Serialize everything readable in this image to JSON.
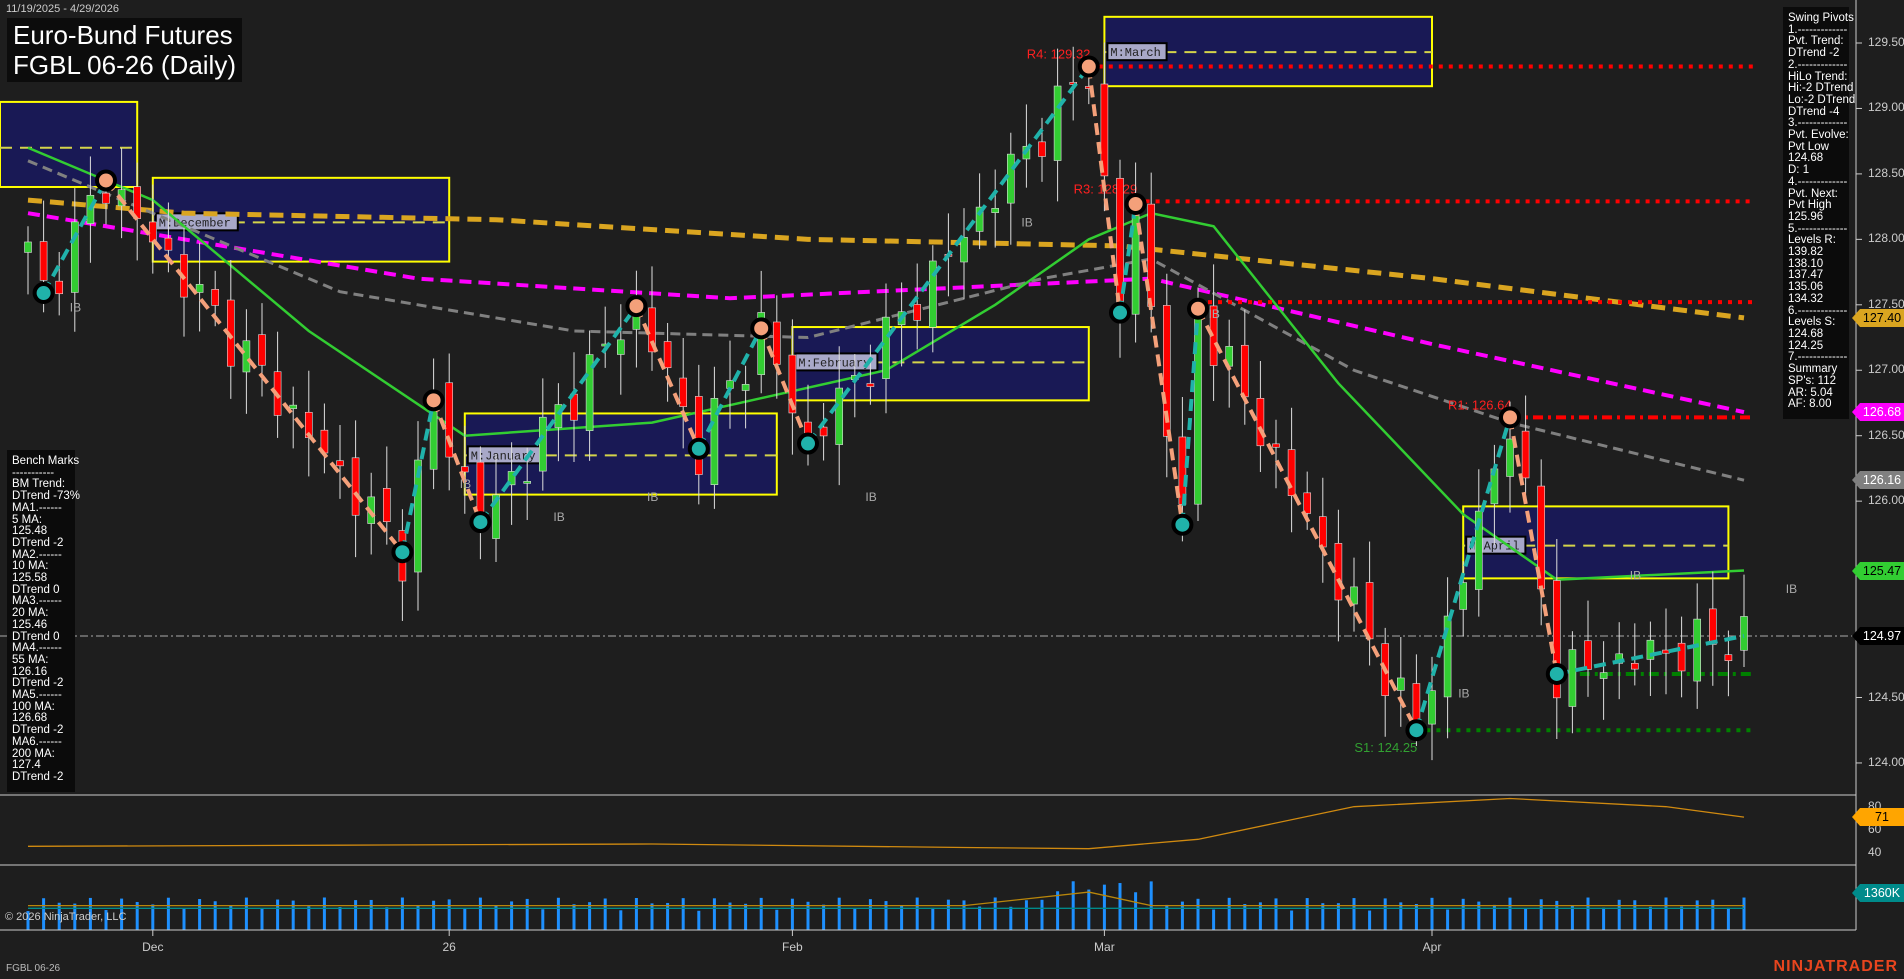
{
  "header": {
    "date_range": "11/19/2025 - 4/29/2026",
    "title_line1": "Euro-Bund Futures",
    "title_line2": "FGBL 06-26 (Daily)"
  },
  "swing_pivots_panel": [
    "Swing Pivots",
    "1.-------------",
    "Pvt. Trend:",
    "DTrend -2",
    "2.-------------",
    "HiLo Trend:",
    "Hi:-2 DTrend",
    "Lo:-2 DTrend",
    "DTrend -4",
    "3.-------------",
    "Pvt. Evolve:",
    "Pvt Low",
    "124.68",
    "D: 1",
    "4.-------------",
    "Pvt. Next:",
    "Pvt High",
    "125.96",
    "5.-------------",
    "Levels R:",
    "139.82",
    "138.10",
    "137.47",
    "135.06",
    "134.32",
    "6.-------------",
    "Levels S:",
    "124.68",
    "124.25",
    "7.-------------",
    "Summary",
    "SP's: 112",
    "AR: 5.04",
    "AF: 8.00"
  ],
  "bench_marks_panel": [
    "Bench Marks",
    "-----------",
    "BM Trend:",
    "DTrend -73%",
    "MA1.------",
    "5 MA:",
    "125.48",
    "DTrend -2",
    "MA2.------",
    "10 MA:",
    "125.58",
    "DTrend 0",
    "MA3.------",
    "20 MA:",
    "125.46",
    "DTrend 0",
    "MA4.------",
    "55 MA:",
    "126.16",
    "DTrend -2",
    "MA5.------",
    "100 MA:",
    "126.68",
    "DTrend -2",
    "MA6.------",
    "200 MA:",
    "127.4",
    "DTrend -2"
  ],
  "price_axis": {
    "ticks": [
      "129.50",
      "129.00",
      "128.50",
      "128.00",
      "127.50",
      "127.00",
      "126.50",
      "126.00",
      "124.50",
      "124.00"
    ],
    "tick_values": [
      129.5,
      129.0,
      128.5,
      128.0,
      127.5,
      127.0,
      126.5,
      126.0,
      124.5,
      124.0
    ]
  },
  "price_tags": [
    {
      "label": "127.40",
      "value": 127.4,
      "bg": "#daa520",
      "fg": "#000"
    },
    {
      "label": "126.68",
      "value": 126.68,
      "bg": "#ff00ff",
      "fg": "#fff"
    },
    {
      "label": "126.16",
      "value": 126.16,
      "bg": "#808080",
      "fg": "#fff"
    },
    {
      "label": "125.47",
      "value": 125.47,
      "bg": "#32cd32",
      "fg": "#000"
    },
    {
      "label": "124.97",
      "value": 124.97,
      "bg": "#000000",
      "fg": "#fff"
    }
  ],
  "indicator_axis": {
    "ticks": [
      "80",
      "60",
      "40"
    ],
    "tag": "71",
    "tag_color": "#ffa500"
  },
  "volume_axis": {
    "tag": "1360K",
    "tag_color": "#008b8b"
  },
  "date_axis": [
    {
      "label": "Dec",
      "bar": 8
    },
    {
      "label": "26",
      "bar": 27
    },
    {
      "label": "Feb",
      "bar": 49
    },
    {
      "label": "Mar",
      "bar": 69
    },
    {
      "label": "Apr",
      "bar": 90
    }
  ],
  "footer": {
    "symbol": "FGBL 06-26",
    "copyright": "© 2026 NinjaTrader, LLC",
    "logo": "NINJATRADER"
  },
  "ib_label": "IB",
  "colors": {
    "up": "#32cd32",
    "down": "#ff0000",
    "zig_up": "#20b2aa",
    "zig_down": "#f4a07a",
    "box": "#191955",
    "box_border": "#ffff00"
  },
  "chart_data": {
    "type": "candlestick",
    "title": "Euro-Bund Futures FGBL 06-26 (Daily)",
    "bars": 111,
    "ylim": [
      123.9,
      129.75
    ],
    "swing_pivots": [
      [
        0,
        127.9
      ],
      [
        1,
        127.59
      ],
      [
        5,
        128.45
      ],
      [
        24,
        125.61
      ],
      [
        26,
        126.77
      ],
      [
        29,
        125.84
      ],
      [
        39,
        127.49
      ],
      [
        43,
        126.4
      ],
      [
        47,
        127.32
      ],
      [
        50,
        126.44
      ],
      [
        68,
        129.32
      ],
      [
        70,
        127.44
      ],
      [
        71,
        128.27
      ],
      [
        74,
        125.82
      ],
      [
        75,
        127.47
      ],
      [
        89,
        124.25
      ],
      [
        95,
        126.64
      ],
      [
        98,
        124.68
      ],
      [
        110,
        124.97
      ]
    ],
    "moving_averages": [
      {
        "name": "200 MA",
        "value": 127.4,
        "color": "#daa520",
        "dash": "14 8",
        "width": 5,
        "points": [
          [
            0,
            128.3
          ],
          [
            10,
            128.2
          ],
          [
            30,
            128.15
          ],
          [
            50,
            128.0
          ],
          [
            70,
            127.95
          ],
          [
            90,
            127.7
          ],
          [
            110,
            127.4
          ]
        ]
      },
      {
        "name": "100 MA",
        "value": 126.68,
        "color": "#ff00ff",
        "dash": "12 7",
        "width": 4,
        "points": [
          [
            0,
            128.2
          ],
          [
            10,
            128.0
          ],
          [
            25,
            127.7
          ],
          [
            45,
            127.55
          ],
          [
            72,
            127.7
          ],
          [
            90,
            127.2
          ],
          [
            110,
            126.68
          ]
        ]
      },
      {
        "name": "55 MA",
        "value": 126.16,
        "color": "#808080",
        "dash": "10 6",
        "width": 3,
        "points": [
          [
            0,
            128.6
          ],
          [
            10,
            128.1
          ],
          [
            20,
            127.6
          ],
          [
            35,
            127.3
          ],
          [
            50,
            127.25
          ],
          [
            65,
            127.7
          ],
          [
            72,
            127.85
          ],
          [
            85,
            127.0
          ],
          [
            95,
            126.6
          ],
          [
            110,
            126.16
          ]
        ]
      },
      {
        "name": "20 MA",
        "value": 125.47,
        "color": "#32cd32",
        "dash": "",
        "width": 2.5,
        "points": [
          [
            0,
            128.7
          ],
          [
            8,
            128.3
          ],
          [
            18,
            127.3
          ],
          [
            28,
            126.5
          ],
          [
            40,
            126.6
          ],
          [
            55,
            127.0
          ],
          [
            62,
            127.5
          ],
          [
            68,
            128.0
          ],
          [
            72,
            128.2
          ],
          [
            76,
            128.1
          ],
          [
            84,
            126.9
          ],
          [
            92,
            125.9
          ],
          [
            98,
            125.4
          ],
          [
            110,
            125.47
          ]
        ]
      }
    ],
    "monthly_boxes": [
      {
        "label": "",
        "from": -3,
        "to": 7,
        "low": 128.4,
        "high": 129.05,
        "mid": 128.7
      },
      {
        "label": "M:December",
        "from": 8,
        "to": 27,
        "low": 127.83,
        "high": 128.47,
        "mid": 128.13
      },
      {
        "label": "M:January",
        "from": 28,
        "to": 48,
        "low": 126.05,
        "high": 126.67,
        "mid": 126.35
      },
      {
        "label": "M:February",
        "from": 49,
        "to": 68,
        "low": 126.77,
        "high": 127.33,
        "mid": 127.06
      },
      {
        "label": "M:March",
        "from": 69,
        "to": 90,
        "low": 129.17,
        "high": 129.7,
        "mid": 129.43
      },
      {
        "label": "M:April",
        "from": 92,
        "to": 109,
        "low": 125.41,
        "high": 125.96,
        "mid": 125.66
      }
    ],
    "levels": [
      {
        "label": "R4: 129.32",
        "value": 129.32,
        "from": 68,
        "color": "#ff0000",
        "style": "dot"
      },
      {
        "label": "R3: 128.29",
        "value": 128.29,
        "from": 71,
        "color": "#ff0000",
        "style": "dot"
      },
      {
        "label": "",
        "value": 127.52,
        "from": 75,
        "color": "#ff0000",
        "style": "dot"
      },
      {
        "label": "R1: 126.64",
        "value": 126.64,
        "from": 95,
        "color": "#ff0000",
        "style": "dashdot"
      },
      {
        "label": "S1: 124.25",
        "value": 124.25,
        "from": 89,
        "color": "#008000",
        "style": "dot"
      },
      {
        "label": "",
        "value": 124.68,
        "from": 98,
        "color": "#008000",
        "style": "dashdot"
      }
    ],
    "last_price": 124.97,
    "indicator": {
      "ylim": [
        30,
        90
      ],
      "points": [
        [
          0,
          46
        ],
        [
          20,
          47
        ],
        [
          40,
          48
        ],
        [
          60,
          45
        ],
        [
          68,
          44
        ],
        [
          75,
          52
        ],
        [
          85,
          80
        ],
        [
          95,
          87
        ],
        [
          105,
          80
        ],
        [
          110,
          71
        ]
      ],
      "last": 71
    },
    "volume": {
      "ylim": [
        0,
        2400
      ],
      "last_k": 1360
    }
  }
}
